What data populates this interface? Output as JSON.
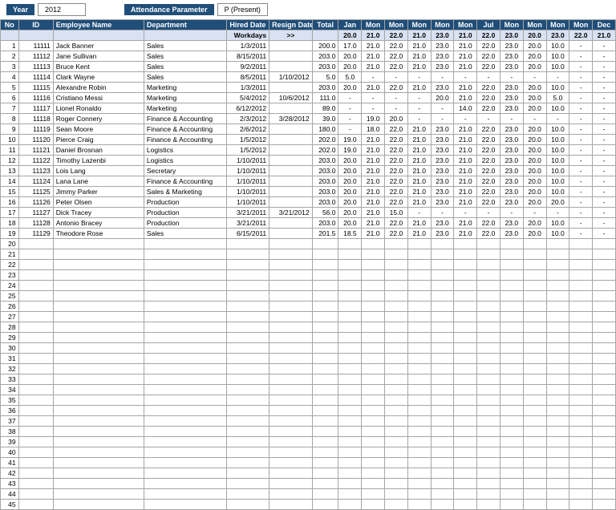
{
  "top": {
    "year_label": "Year",
    "year_value": "2012",
    "param_label": "Attendance Parameter",
    "param_value": "P (Present)"
  },
  "headers": {
    "no": "No",
    "id": "ID",
    "name": "Employee Name",
    "dept": "Department",
    "hired": "Hired Date",
    "resign": "Resign Date",
    "total": "Total",
    "months": [
      "Jan",
      "Mon",
      "Mon",
      "Mon",
      "Mon",
      "Mon",
      "Jul",
      "Mon",
      "Mon",
      "Mon",
      "Mon",
      "Dec"
    ],
    "sub_label": "Workdays",
    "sub_arrow": ">>",
    "workdays": [
      "20.0",
      "21.0",
      "22.0",
      "21.0",
      "23.0",
      "21.0",
      "22.0",
      "23.0",
      "20.0",
      "23.0",
      "22.0",
      "21.0"
    ]
  },
  "rows": [
    {
      "no": 1,
      "id": "11111",
      "name": "Jack Banner",
      "dept": "Sales",
      "hired": "1/3/2011",
      "resign": "",
      "total": "200.0",
      "m": [
        "17.0",
        "21.0",
        "22.0",
        "21.0",
        "23.0",
        "21.0",
        "22.0",
        "23.0",
        "20.0",
        "10.0",
        "-",
        "-"
      ]
    },
    {
      "no": 2,
      "id": "11112",
      "name": "Jane Sullivan",
      "dept": "Sales",
      "hired": "8/15/2011",
      "resign": "",
      "total": "203.0",
      "m": [
        "20.0",
        "21.0",
        "22.0",
        "21.0",
        "23.0",
        "21.0",
        "22.0",
        "23.0",
        "20.0",
        "10.0",
        "-",
        "-"
      ]
    },
    {
      "no": 3,
      "id": "11113",
      "name": "Bruce Kent",
      "dept": "Sales",
      "hired": "9/2/2011",
      "resign": "",
      "total": "203.0",
      "m": [
        "20.0",
        "21.0",
        "22.0",
        "21.0",
        "23.0",
        "21.0",
        "22.0",
        "23.0",
        "20.0",
        "10.0",
        "-",
        "-"
      ]
    },
    {
      "no": 4,
      "id": "11114",
      "name": "Clark Wayne",
      "dept": "Sales",
      "hired": "8/5/2011",
      "resign": "1/10/2012",
      "total": "5.0",
      "m": [
        "5.0",
        "-",
        "-",
        "-",
        "-",
        "-",
        "-",
        "-",
        "-",
        "-",
        "-",
        "-"
      ]
    },
    {
      "no": 5,
      "id": "11115",
      "name": "Alexandre Robin",
      "dept": "Marketing",
      "hired": "1/3/2011",
      "resign": "",
      "total": "203.0",
      "m": [
        "20.0",
        "21.0",
        "22.0",
        "21.0",
        "23.0",
        "21.0",
        "22.0",
        "23.0",
        "20.0",
        "10.0",
        "-",
        "-"
      ]
    },
    {
      "no": 6,
      "id": "11116",
      "name": "Cristiano Messi",
      "dept": "Marketing",
      "hired": "5/4/2012",
      "resign": "10/6/2012",
      "total": "111.0",
      "m": [
        "-",
        "-",
        "-",
        "-",
        "20.0",
        "21.0",
        "22.0",
        "23.0",
        "20.0",
        "5.0",
        "-",
        "-"
      ]
    },
    {
      "no": 7,
      "id": "11117",
      "name": "Lionel Ronaldo",
      "dept": "Marketing",
      "hired": "6/12/2012",
      "resign": "",
      "total": "89.0",
      "m": [
        "-",
        "-",
        "-",
        "-",
        "-",
        "14.0",
        "22.0",
        "23.0",
        "20.0",
        "10.0",
        "-",
        "-"
      ]
    },
    {
      "no": 8,
      "id": "11118",
      "name": "Roger Connery",
      "dept": "Finance & Accounting",
      "hired": "2/3/2012",
      "resign": "3/28/2012",
      "total": "39.0",
      "m": [
        "-",
        "19.0",
        "20.0",
        "-",
        "-",
        "-",
        "-",
        "-",
        "-",
        "-",
        "-",
        "-"
      ]
    },
    {
      "no": 9,
      "id": "11119",
      "name": "Sean Moore",
      "dept": "Finance & Accounting",
      "hired": "2/6/2012",
      "resign": "",
      "total": "180.0",
      "m": [
        "-",
        "18.0",
        "22.0",
        "21.0",
        "23.0",
        "21.0",
        "22.0",
        "23.0",
        "20.0",
        "10.0",
        "-",
        "-"
      ]
    },
    {
      "no": 10,
      "id": "11120",
      "name": "Pierce Craig",
      "dept": "Finance & Accounting",
      "hired": "1/5/2012",
      "resign": "",
      "total": "202.0",
      "m": [
        "19.0",
        "21.0",
        "22.0",
        "21.0",
        "23.0",
        "21.0",
        "22.0",
        "23.0",
        "20.0",
        "10.0",
        "-",
        "-"
      ]
    },
    {
      "no": 11,
      "id": "11121",
      "name": "Daniel Brosnan",
      "dept": "Logistics",
      "hired": "1/5/2012",
      "resign": "",
      "total": "202.0",
      "m": [
        "19.0",
        "21.0",
        "22.0",
        "21.0",
        "23.0",
        "21.0",
        "22.0",
        "23.0",
        "20.0",
        "10.0",
        "-",
        "-"
      ]
    },
    {
      "no": 12,
      "id": "11122",
      "name": "Timothy Lazenbi",
      "dept": "Logistics",
      "hired": "1/10/2011",
      "resign": "",
      "total": "203.0",
      "m": [
        "20.0",
        "21.0",
        "22.0",
        "21.0",
        "23.0",
        "21.0",
        "22.0",
        "23.0",
        "20.0",
        "10.0",
        "-",
        "-"
      ]
    },
    {
      "no": 13,
      "id": "11123",
      "name": "Lois Lang",
      "dept": "Secretary",
      "hired": "1/10/2011",
      "resign": "",
      "total": "203.0",
      "m": [
        "20.0",
        "21.0",
        "22.0",
        "21.0",
        "23.0",
        "21.0",
        "22.0",
        "23.0",
        "20.0",
        "10.0",
        "-",
        "-"
      ]
    },
    {
      "no": 14,
      "id": "11124",
      "name": "Lana Lane",
      "dept": "Finance & Accounting",
      "hired": "1/10/2011",
      "resign": "",
      "total": "203.0",
      "m": [
        "20.0",
        "21.0",
        "22.0",
        "21.0",
        "23.0",
        "21.0",
        "22.0",
        "23.0",
        "20.0",
        "10.0",
        "-",
        "-"
      ]
    },
    {
      "no": 15,
      "id": "11125",
      "name": "Jimmy Parker",
      "dept": "Sales & Marketing",
      "hired": "1/10/2011",
      "resign": "",
      "total": "203.0",
      "m": [
        "20.0",
        "21.0",
        "22.0",
        "21.0",
        "23.0",
        "21.0",
        "22.0",
        "23.0",
        "20.0",
        "10.0",
        "-",
        "-"
      ]
    },
    {
      "no": 16,
      "id": "11126",
      "name": "Peter Olsen",
      "dept": "Production",
      "hired": "1/10/2011",
      "resign": "",
      "total": "203.0",
      "m": [
        "20.0",
        "21.0",
        "22.0",
        "21.0",
        "23.0",
        "21.0",
        "22.0",
        "23.0",
        "20.0",
        "20.0",
        "-",
        "-"
      ]
    },
    {
      "no": 17,
      "id": "11127",
      "name": "Dick Tracey",
      "dept": "Production",
      "hired": "3/21/2011",
      "resign": "3/21/2012",
      "total": "56.0",
      "m": [
        "20.0",
        "21.0",
        "15.0",
        "-",
        "-",
        "-",
        "-",
        "-",
        "-",
        "-",
        "-",
        "-"
      ]
    },
    {
      "no": 18,
      "id": "11128",
      "name": "Antonio Bracey",
      "dept": "Production",
      "hired": "3/21/2011",
      "resign": "",
      "total": "203.0",
      "m": [
        "20.0",
        "21.0",
        "22.0",
        "21.0",
        "23.0",
        "21.0",
        "22.0",
        "23.0",
        "20.0",
        "10.0",
        "-",
        "-"
      ]
    },
    {
      "no": 19,
      "id": "11129",
      "name": "Theodore Rose",
      "dept": "Sales",
      "hired": "6/15/2011",
      "resign": "",
      "total": "201.5",
      "m": [
        "18.5",
        "21.0",
        "22.0",
        "21.0",
        "23.0",
        "21.0",
        "22.0",
        "23.0",
        "20.0",
        "10.0",
        "-",
        "-"
      ]
    }
  ],
  "empty_start": 20,
  "empty_end": 45
}
